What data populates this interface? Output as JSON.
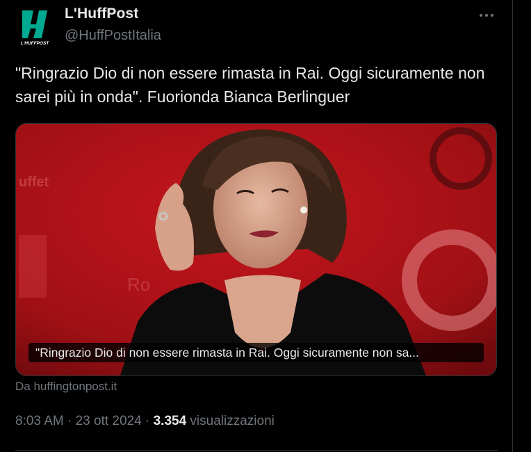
{
  "author": {
    "name": "L'HuffPost",
    "handle": "@HuffPostItalia",
    "logo_text": "L'HUFFPOST",
    "logo_color": "#00a98f"
  },
  "more_icon": "ellipsis-icon",
  "tweet": {
    "text": "\"Ringrazio Dio di non essere rimasta in Rai. Oggi sicuramente non sarei più in onda\". Fuorionda Bianca Berlinguer"
  },
  "card": {
    "caption": "\"Ringrazio Dio di non essere rimasta in Rai. Oggi sicuramente non sa...",
    "source": "Da huffingtonpost.it",
    "background_color": "#b3141b"
  },
  "meta": {
    "time": "8:03 AM",
    "separator": "·",
    "date": "23 ott 2024",
    "views_count": "3.354",
    "views_label": "visualizzazioni"
  }
}
